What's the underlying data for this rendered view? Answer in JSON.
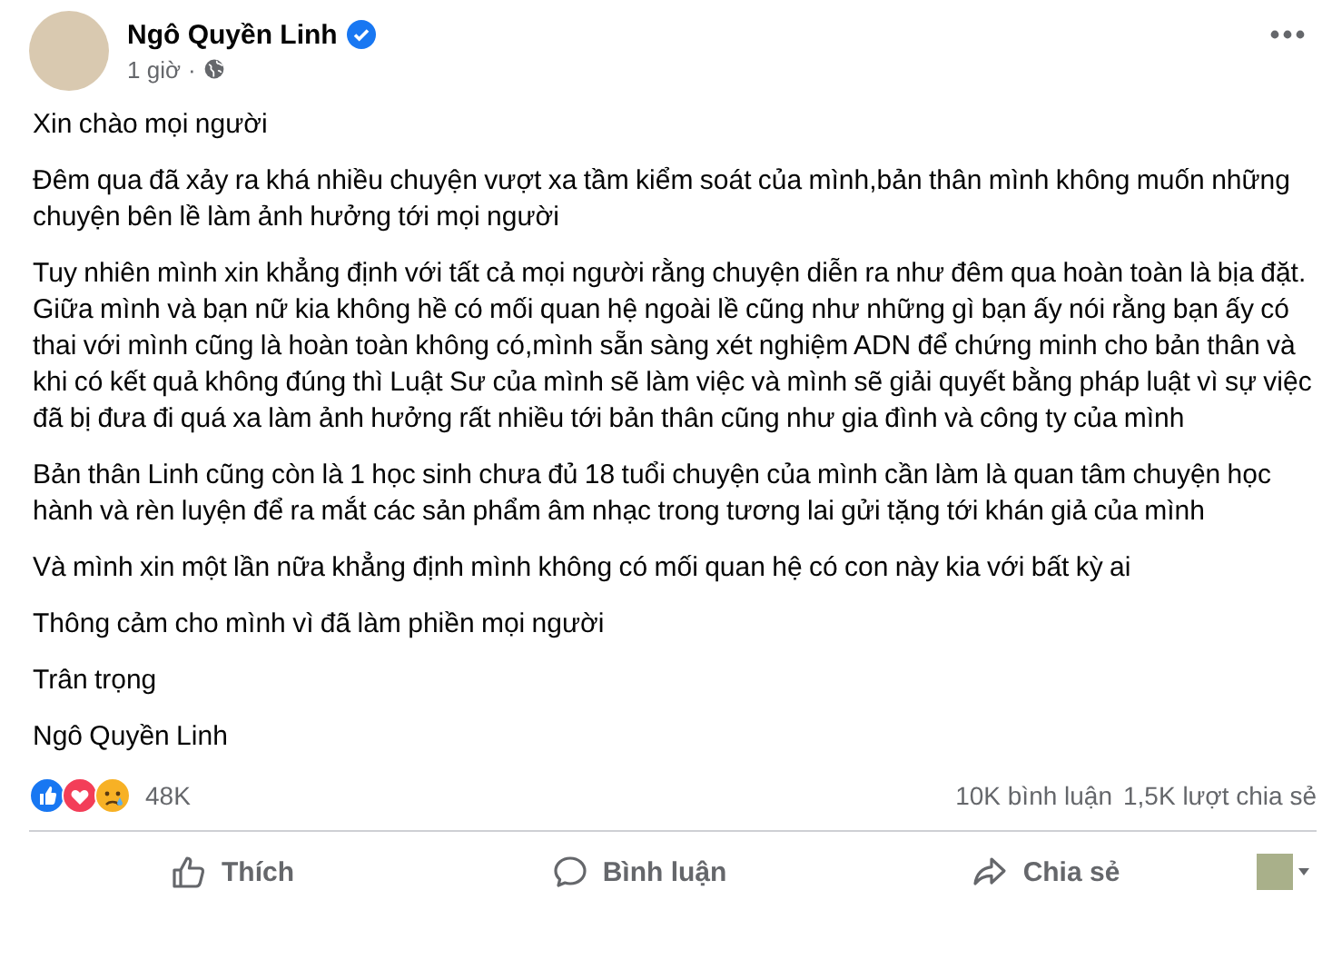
{
  "post": {
    "author": "Ngô Quyền Linh",
    "verified": true,
    "time": "1 giờ",
    "separator": "·",
    "paragraphs": [
      "Xin chào mọi người",
      "Đêm qua đã xảy ra khá nhiều chuyện vượt xa tầm kiểm soát của mình,bản thân mình không muốn những chuyện bên lề làm ảnh hưởng tới mọi người",
      "Tuy nhiên mình xin khẳng định với tất cả mọi người rằng chuyện diễn ra như đêm qua hoàn toàn là bịa đặt. Giữa mình và bạn nữ kia không hề có mối quan hệ ngoài lề cũng như những gì bạn ấy nói rằng bạn ấy có thai với mình cũng là hoàn toàn không có,mình sẵn sàng xét nghiệm ADN để chứng minh cho bản thân và khi có kết quả không đúng thì Luật Sư của mình sẽ làm việc và mình sẽ giải quyết bằng pháp luật vì sự việc đã bị đưa đi quá xa làm ảnh hưởng rất nhiều tới bản thân cũng như gia đình và công ty của mình",
      "Bản thân Linh cũng còn là 1 học sinh chưa đủ 18 tuổi chuyện của mình cần làm là quan tâm chuyện học hành và rèn luyện để ra mắt các sản phẩm âm nhạc trong tương lai gửi tặng tới khán giả của mình",
      "Và mình xin một lần nữa khẳng định mình không có mối quan hệ có con này kia với bất kỳ ai",
      "Thông cảm cho mình vì đã làm phiền mọi người",
      "Trân trọng",
      "Ngô Quyền Linh"
    ],
    "reactions": {
      "count": "48K",
      "comments": "10K bình luận",
      "shares": "1,5K lượt chia sẻ"
    },
    "actions": [
      {
        "kind": "like",
        "label": "Thích"
      },
      {
        "kind": "comment",
        "label": "Bình luận"
      },
      {
        "kind": "share",
        "label": "Chia sẻ"
      }
    ]
  }
}
